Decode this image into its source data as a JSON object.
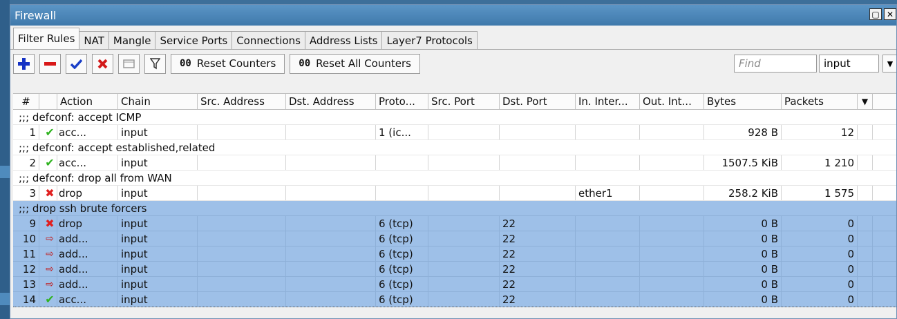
{
  "window": {
    "title": "Firewall"
  },
  "tabs": [
    "Filter Rules",
    "NAT",
    "Mangle",
    "Service Ports",
    "Connections",
    "Address Lists",
    "Layer7 Protocols"
  ],
  "toolbar": {
    "reset_counters": "Reset Counters",
    "reset_all_counters": "Reset All Counters",
    "counter_glyph": "00",
    "find_placeholder": "Find",
    "chain_filter": "input"
  },
  "columns": [
    "#",
    "",
    "Action",
    "Chain",
    "Src. Address",
    "Dst. Address",
    "Proto...",
    "Src. Port",
    "Dst. Port",
    "In. Inter...",
    "Out. Int...",
    "Bytes",
    "Packets"
  ],
  "rows": [
    {
      "type": "comment",
      "text": ";;; defconf: accept ICMP"
    },
    {
      "type": "rule",
      "num": "1",
      "action_icon": "accept-icon",
      "action": "acc...",
      "chain": "input",
      "src_address": "",
      "dst_address": "",
      "proto": "1 (ic...",
      "src_port": "",
      "dst_port": "",
      "in_interface": "",
      "out_interface": "",
      "bytes": "928 B",
      "packets": "12"
    },
    {
      "type": "comment",
      "text": ";;; defconf: accept established,related"
    },
    {
      "type": "rule",
      "num": "2",
      "action_icon": "accept-icon",
      "action": "acc...",
      "chain": "input",
      "src_address": "",
      "dst_address": "",
      "proto": "",
      "src_port": "",
      "dst_port": "",
      "in_interface": "",
      "out_interface": "",
      "bytes": "1507.5 KiB",
      "packets": "1 210"
    },
    {
      "type": "comment",
      "text": ";;; defconf: drop all from WAN"
    },
    {
      "type": "rule",
      "num": "3",
      "action_icon": "drop-icon",
      "action": "drop",
      "chain": "input",
      "src_address": "",
      "dst_address": "",
      "proto": "",
      "src_port": "",
      "dst_port": "",
      "in_interface": "ether1",
      "out_interface": "",
      "bytes": "258.2 KiB",
      "packets": "1 575"
    },
    {
      "type": "comment",
      "selected": true,
      "text": ";;; drop ssh brute forcers"
    },
    {
      "type": "rule",
      "selected": true,
      "num": "9",
      "action_icon": "drop-icon",
      "action": "drop",
      "chain": "input",
      "src_address": "",
      "dst_address": "",
      "proto": "6 (tcp)",
      "src_port": "",
      "dst_port": "22",
      "in_interface": "",
      "out_interface": "",
      "bytes": "0 B",
      "packets": "0"
    },
    {
      "type": "rule",
      "selected": true,
      "num": "10",
      "action_icon": "add-to-list-icon",
      "action": "add...",
      "chain": "input",
      "src_address": "",
      "dst_address": "",
      "proto": "6 (tcp)",
      "src_port": "",
      "dst_port": "22",
      "in_interface": "",
      "out_interface": "",
      "bytes": "0 B",
      "packets": "0"
    },
    {
      "type": "rule",
      "selected": true,
      "num": "11",
      "action_icon": "add-to-list-icon",
      "action": "add...",
      "chain": "input",
      "src_address": "",
      "dst_address": "",
      "proto": "6 (tcp)",
      "src_port": "",
      "dst_port": "22",
      "in_interface": "",
      "out_interface": "",
      "bytes": "0 B",
      "packets": "0"
    },
    {
      "type": "rule",
      "selected": true,
      "num": "12",
      "action_icon": "add-to-list-icon",
      "action": "add...",
      "chain": "input",
      "src_address": "",
      "dst_address": "",
      "proto": "6 (tcp)",
      "src_port": "",
      "dst_port": "22",
      "in_interface": "",
      "out_interface": "",
      "bytes": "0 B",
      "packets": "0"
    },
    {
      "type": "rule",
      "selected": true,
      "num": "13",
      "action_icon": "add-to-list-icon",
      "action": "add...",
      "chain": "input",
      "src_address": "",
      "dst_address": "",
      "proto": "6 (tcp)",
      "src_port": "",
      "dst_port": "22",
      "in_interface": "",
      "out_interface": "",
      "bytes": "0 B",
      "packets": "0"
    },
    {
      "type": "rule",
      "selected": true,
      "num": "14",
      "action_icon": "accept-icon",
      "action": "acc...",
      "chain": "input",
      "src_address": "",
      "dst_address": "",
      "proto": "6 (tcp)",
      "src_port": "",
      "dst_port": "22",
      "in_interface": "",
      "out_interface": "",
      "bytes": "0 B",
      "packets": "0"
    }
  ],
  "colors": {
    "selection": "#9ec0e8",
    "titlebar": "#4a86b8",
    "accept": "#2fb31f",
    "drop": "#e02020"
  }
}
